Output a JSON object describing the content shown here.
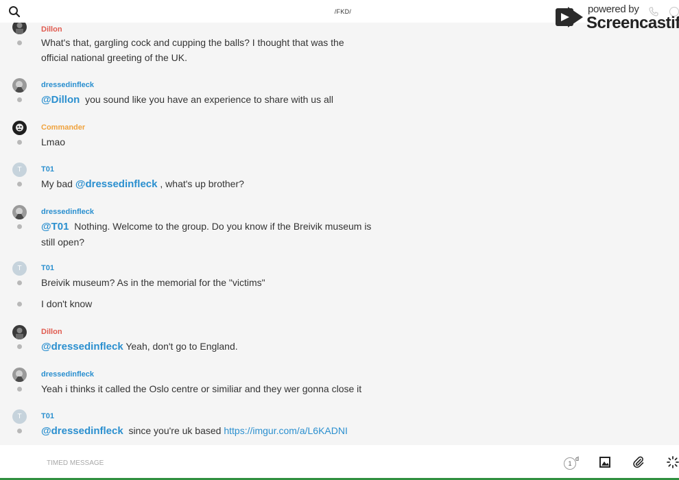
{
  "header": {
    "channel_title": "/FKD/"
  },
  "watermark": {
    "powered_by": "powered by",
    "brand": "Screencastify"
  },
  "colors": {
    "dillon": "#e05a4f",
    "dressedinfleck": "#2a8fcf",
    "commander": "#f0a33e",
    "t01": "#2a8fcf",
    "mention": "#2a8fcf",
    "link": "#2a8fcf",
    "bottom_accent": "#2f8f3f"
  },
  "messages": [
    {
      "user": "Dillon",
      "lines": [
        "What's that, gargling cock and cupping the balls? I thought that was the official national greeting of the UK."
      ]
    },
    {
      "user": "dressedinfleck",
      "mention": "@Dillon",
      "lines": [
        "you sound like you have an experience to share with us all"
      ]
    },
    {
      "user": "Commander",
      "lines": [
        "Lmao"
      ]
    },
    {
      "user": "T01",
      "avatar_letter": "T",
      "text_before": "My bad",
      "mention": "@dressedinfleck",
      "lines": [
        ", what's up brother?"
      ]
    },
    {
      "user": "dressedinfleck",
      "mention": "@T01",
      "lines": [
        "Nothing. Welcome to the group. Do you know if the Breivik museum is still open?"
      ]
    },
    {
      "user": "T01",
      "avatar_letter": "T",
      "lines": [
        "Breivik museum? As in the memorial for the \"victims\"",
        "I don't know"
      ]
    },
    {
      "user": "Dillon",
      "mention": "@dressedinfleck",
      "lines": [
        "Yeah, don't go to England."
      ]
    },
    {
      "user": "dressedinfleck",
      "lines": [
        "Yeah i thinks it called the Oslo centre or similiar and they wer gonna close it"
      ]
    },
    {
      "user": "T01",
      "avatar_letter": "T",
      "mention": "@dressedinfleck",
      "text_after": "since you're uk based",
      "link": "https://imgur.com/a/L6KADNI"
    }
  ],
  "composer": {
    "placeholder": "TIMED MESSAGE",
    "timer_value": "1",
    "timer_unit": "d"
  },
  "icons": {
    "search": "search-icon",
    "image": "image-icon",
    "attach": "paperclip-icon",
    "loading": "loading-spinner-icon",
    "phone": "phone-icon",
    "info": "info-icon"
  }
}
